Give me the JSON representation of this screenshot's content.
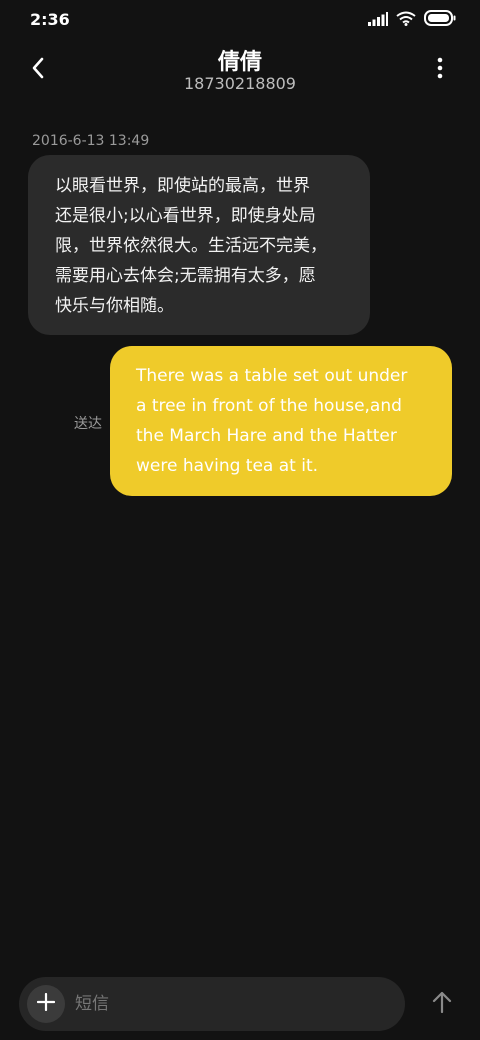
{
  "status_bar": {
    "time": "2:36",
    "icons": [
      "signal-icon",
      "wifi-icon",
      "battery-icon"
    ]
  },
  "header": {
    "contact_name": "倩倩",
    "contact_number": "18730218809",
    "back_icon": "back-chevron-icon",
    "more_icon": "more-vertical-icon"
  },
  "conversation": {
    "timestamp": "2016-6-13 13:49",
    "messages": [
      {
        "direction": "incoming",
        "lines": [
          "以眼看世界，即使站的最高，世界",
          "还是很小;以心看世界，即使身处局",
          "限，世界依然很大。生活远不完美，",
          "需要用心去体会;无需拥有太多，愿",
          "快乐与你相随。"
        ]
      },
      {
        "direction": "outgoing",
        "status": "送达",
        "lines": [
          "There was a table set out under",
          "a tree in front of the house,and",
          "the March Hare and the Hatter",
          "were having tea at it."
        ]
      }
    ]
  },
  "composer": {
    "placeholder": "短信",
    "add_icon": "plus-icon",
    "send_icon": "arrow-up-icon"
  },
  "colors": {
    "background": "#121212",
    "incoming_bubble": "#2b2b2b",
    "outgoing_bubble": "#efcb2a",
    "muted_text": "#9a9a9a"
  }
}
